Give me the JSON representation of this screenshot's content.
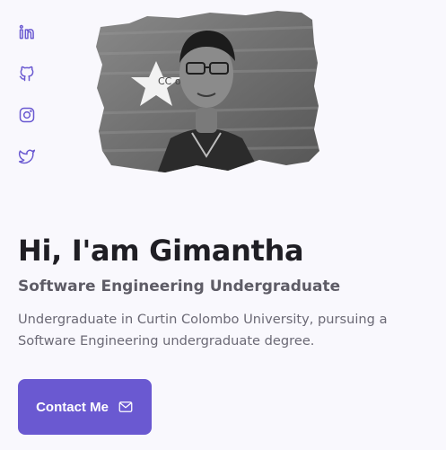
{
  "social": [
    {
      "icon": "linkedin-icon"
    },
    {
      "icon": "github-icon"
    },
    {
      "icon": "instagram-icon"
    },
    {
      "icon": "twitter-icon"
    }
  ],
  "profile": {
    "image_text": "CC olombo im"
  },
  "hero": {
    "name": "Hi, I'am Gimantha",
    "subtitle": "Software Engineering Undergraduate",
    "description": "Undergraduate in Curtin Colombo University, pursuing a Software Engineering undergraduate degree.",
    "contact_label": "Contact Me",
    "contact_icon": "mail-icon"
  },
  "colors": {
    "accent": "#6a59d1",
    "background": "#f9f8fd",
    "heading": "#1f1e24",
    "subtitle": "#5e5c66",
    "body": "#6b6975"
  }
}
